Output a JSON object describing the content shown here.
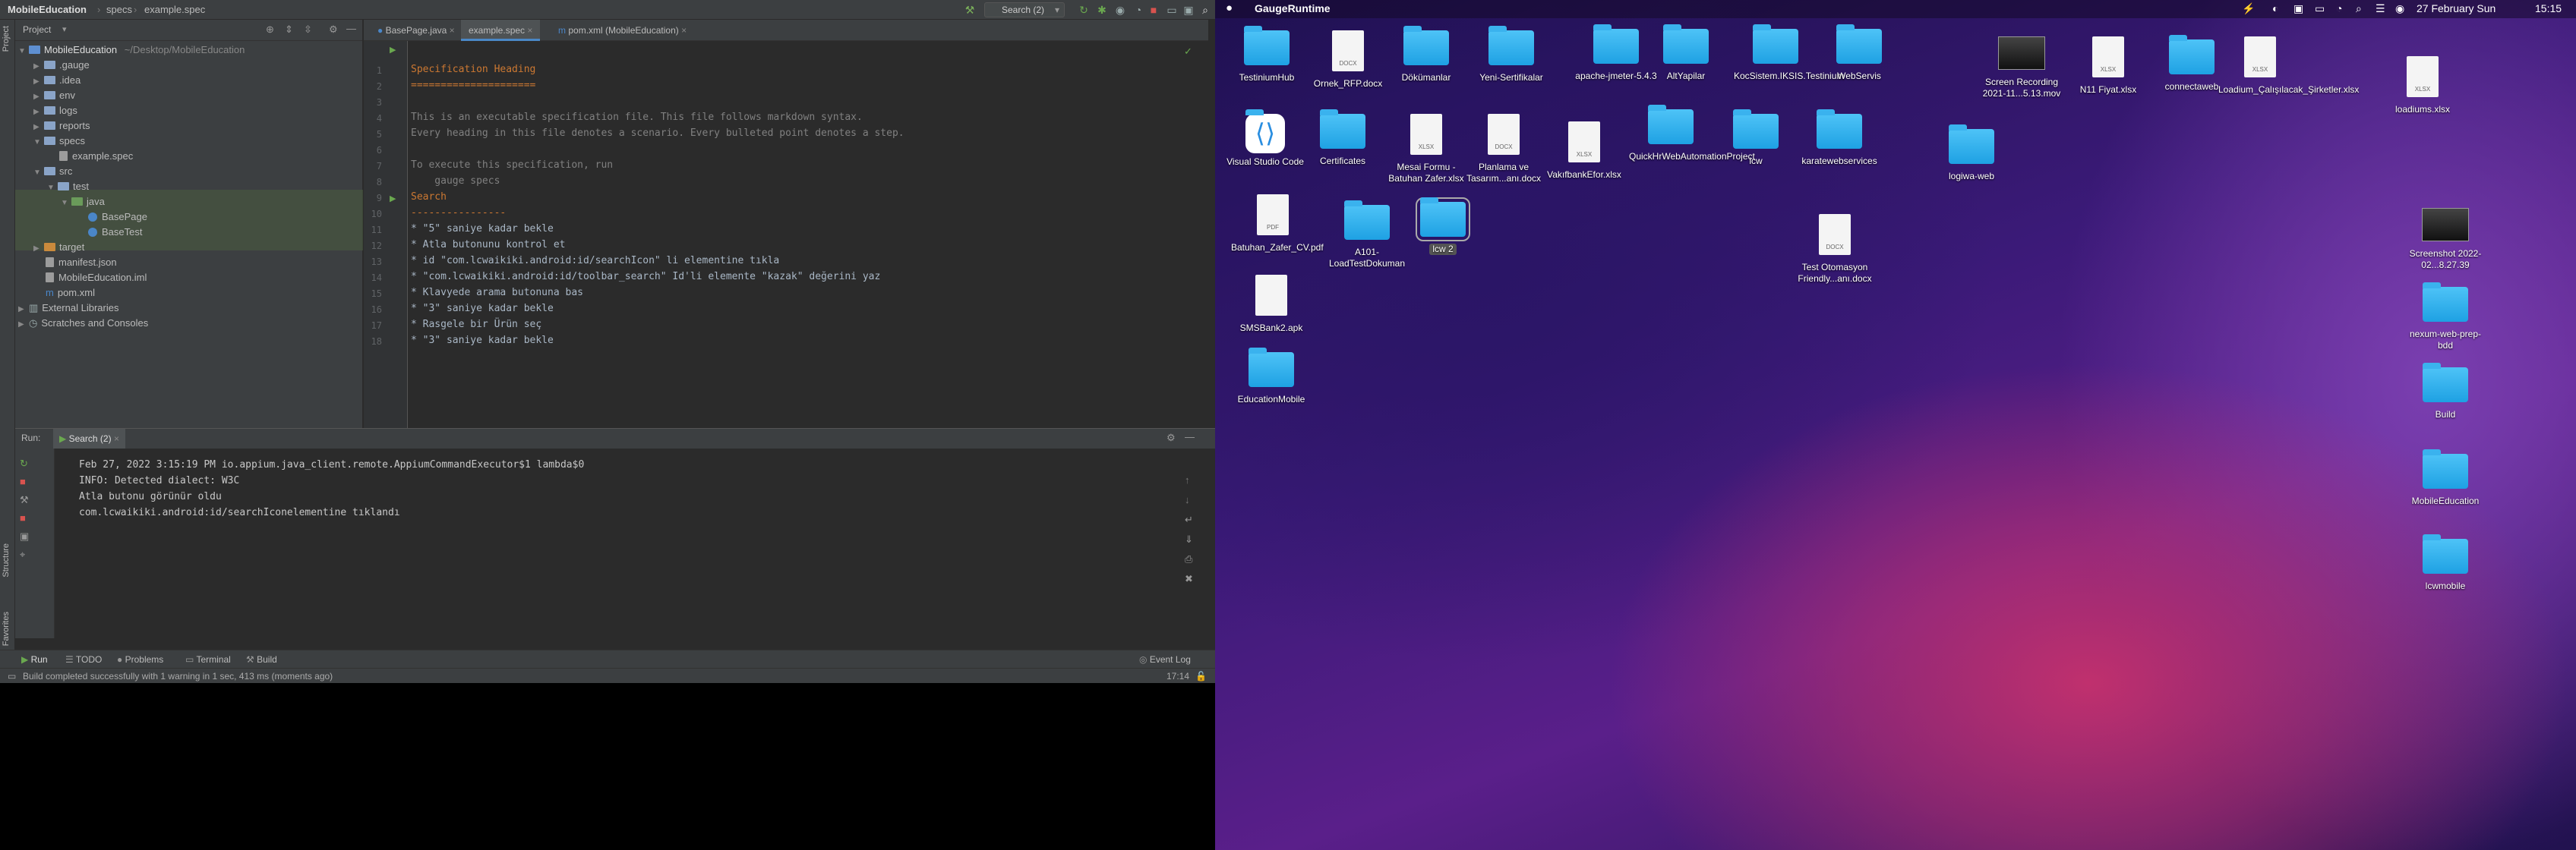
{
  "ide": {
    "app_name": "MobileEducation",
    "breadcrumb": [
      "specs",
      "example.spec"
    ],
    "run_config": "Search (2)",
    "left_strip_tabs": [
      "Project",
      "Structure",
      "Favorites"
    ],
    "project_panel": {
      "title": "Project",
      "tree": [
        {
          "label": "MobileEducation",
          "suffix": "~/Desktop/MobileEducation",
          "icon": "folder-icon"
        },
        {
          "label": ".gauge",
          "icon": "folder-icon"
        },
        {
          "label": ".idea",
          "icon": "folder-icon"
        },
        {
          "label": "env",
          "icon": "folder-icon"
        },
        {
          "label": "logs",
          "icon": "folder-icon"
        },
        {
          "label": "reports",
          "icon": "folder-icon"
        },
        {
          "label": "specs",
          "icon": "folder-icon"
        },
        {
          "label": "example.spec",
          "icon": "file-icon"
        },
        {
          "label": "src",
          "icon": "folder-icon"
        },
        {
          "label": "test",
          "icon": "folder-icon"
        },
        {
          "label": "java",
          "icon": "folder-icon"
        },
        {
          "label": "BasePage",
          "icon": "java-class-icon"
        },
        {
          "label": "BaseTest",
          "icon": "java-class-icon"
        },
        {
          "label": "target",
          "icon": "folder-icon"
        },
        {
          "label": "manifest.json",
          "icon": "file-icon"
        },
        {
          "label": "MobileEducation.iml",
          "icon": "file-icon"
        },
        {
          "label": "pom.xml",
          "icon": "maven-icon"
        },
        {
          "label": "External Libraries",
          "icon": "library-icon"
        },
        {
          "label": "Scratches and Consoles",
          "icon": "scratch-icon"
        }
      ]
    },
    "editor": {
      "tabs": [
        "BasePage.java",
        "example.spec",
        "pom.xml (MobileEducation)"
      ],
      "active_tab": "example.spec",
      "lines": [
        {
          "num": "1",
          "text": "Specification Heading"
        },
        {
          "num": "2",
          "text": "====================="
        },
        {
          "num": "3",
          "text": ""
        },
        {
          "num": "4",
          "text": "This is an executable specification file. This file follows markdown syntax."
        },
        {
          "num": "5",
          "text": "Every heading in this file denotes a scenario. Every bulleted point denotes a step."
        },
        {
          "num": "6",
          "text": ""
        },
        {
          "num": "7",
          "text": "To execute this specification, run"
        },
        {
          "num": "8",
          "text": "    gauge specs"
        },
        {
          "num": "9",
          "text": "Search"
        },
        {
          "num": "10",
          "text": "----------------"
        },
        {
          "num": "11",
          "text": "* \"5\" saniye kadar bekle"
        },
        {
          "num": "12",
          "text": "* Atla butonunu kontrol et"
        },
        {
          "num": "13",
          "text": "* id \"com.lcwaikiki.android:id/searchIcon\" li elementine tıkla"
        },
        {
          "num": "14",
          "text": "* \"com.lcwaikiki.android:id/toolbar_search\" Id'li elemente \"kazak\" değerini yaz"
        },
        {
          "num": "15",
          "text": "* Klavyede arama butonuna bas"
        },
        {
          "num": "16",
          "text": "* \"3\" saniye kadar bekle"
        },
        {
          "num": "17",
          "text": "* Rasgele bir Ürün seç"
        },
        {
          "num": "18",
          "text": "* \"3\" saniye kadar bekle"
        }
      ]
    },
    "run_panel": {
      "label": "Run:",
      "tab": "Search (2)",
      "console": [
        "Feb 27, 2022 3:15:19 PM io.appium.java_client.remote.AppiumCommandExecutor$1 lambda$0",
        "INFO: Detected dialect: W3C",
        "Atla butonu görünür oldu",
        "com.lcwaikiki.android:id/searchIconelementine tıklandı"
      ]
    },
    "bottom_tabs": [
      "Run",
      "TODO",
      "Problems",
      "Terminal",
      "Build"
    ],
    "event_log": "Event Log",
    "status": "Build completed successfully with 1 warning in 1 sec, 413 ms (moments ago)",
    "cursor_pos": "17:14"
  },
  "desktop": {
    "menubar": {
      "app": "GaugeRuntime",
      "date": "27 February Sun",
      "time": "15:15"
    },
    "icons": [
      {
        "label": "TestiniumHub",
        "type": "folder"
      },
      {
        "label": "Ornek_RFP.docx",
        "type": "doc",
        "badge": "DOCX"
      },
      {
        "label": "Dökümanlar",
        "type": "folder"
      },
      {
        "label": "Yeni-Sertifikalar",
        "type": "folder"
      },
      {
        "label": "apache-jmeter-5.4.3",
        "type": "folder"
      },
      {
        "label": "AltYapilar",
        "type": "folder"
      },
      {
        "label": "KocSistem.IKSIS.Testinium",
        "type": "folder"
      },
      {
        "label": "WebServis",
        "type": "folder"
      },
      {
        "label": "Screen Recording 2021-11...5.13.mov",
        "type": "thumb"
      },
      {
        "label": "N11 Fiyat.xlsx",
        "type": "doc",
        "badge": "XLSX"
      },
      {
        "label": "connectaweb",
        "type": "folder"
      },
      {
        "label": "Loadium_Çalışılacak_Şirketler.xlsx",
        "type": "doc",
        "badge": "XLSX"
      },
      {
        "label": "loadiums.xlsx",
        "type": "doc",
        "badge": "XLSX"
      },
      {
        "label": "Visual Studio Code",
        "type": "app"
      },
      {
        "label": "Certificates",
        "type": "folder"
      },
      {
        "label": "Mesai Formu - Batuhan Zafer.xlsx",
        "type": "doc",
        "badge": "XLSX"
      },
      {
        "label": "Planlama ve Tasarım...anı.docx",
        "type": "doc",
        "badge": "DOCX"
      },
      {
        "label": "VakıfbankEfor.xlsx",
        "type": "doc",
        "badge": "XLSX"
      },
      {
        "label": "QuickHrWebAutomationProject",
        "type": "folder"
      },
      {
        "label": "lcw",
        "type": "folder"
      },
      {
        "label": "karatewebservices",
        "type": "folder"
      },
      {
        "label": "logiwa-web",
        "type": "folder"
      },
      {
        "label": "Batuhan_Zafer_CV.pdf",
        "type": "doc",
        "badge": "PDF"
      },
      {
        "label": "A101-LoadTestDokuman",
        "type": "folder"
      },
      {
        "label": "lcw 2",
        "type": "folder",
        "selected": true
      },
      {
        "label": "Test Otomasyon Friendly...anı.docx",
        "type": "doc",
        "badge": "DOCX"
      },
      {
        "label": "Screenshot 2022-02...8.27.39",
        "type": "thumb"
      },
      {
        "label": "nexum-web-prep-bdd",
        "type": "folder"
      },
      {
        "label": "SMSBank2.apk",
        "type": "doc",
        "badge": ""
      },
      {
        "label": "Build",
        "type": "folder"
      },
      {
        "label": "EducationMobile",
        "type": "folder"
      },
      {
        "label": "MobileEducation",
        "type": "folder"
      },
      {
        "label": "lcwmobile",
        "type": "folder"
      }
    ]
  }
}
